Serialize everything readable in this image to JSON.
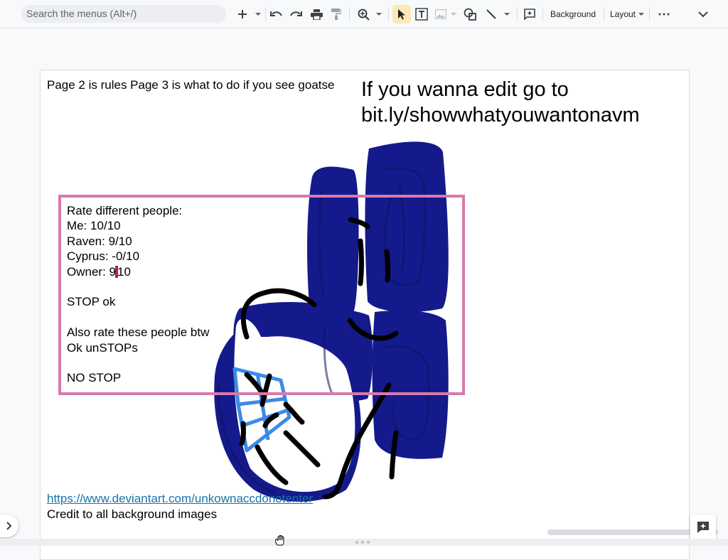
{
  "toolbar": {
    "search_placeholder": "Search the menus (Alt+/)",
    "background_label": "Background",
    "layout_label": "Layout",
    "more_label": "⋯"
  },
  "slide": {
    "top_left_text": "Page 2 is rules Page 3 is what to do if you see goatse",
    "top_right_line1": "If you wanna edit go to",
    "top_right_line2": "bit.ly/showwhatyouwantonavm",
    "rate_lines": [
      "Rate different people:",
      "Me: 10/10",
      "Raven: 9/10",
      "Cyprus: -0/10",
      "",
      "",
      "STOP ok",
      "",
      "Also rate these people btw",
      "Ok unSTOPs",
      "",
      "NO STOP"
    ],
    "owner_prefix": "Owner: 9",
    "owner_suffix": "10",
    "link_text": "https://www.deviantart.com/unkownaccdonotenter",
    "credit_text": "Credit to all background images"
  },
  "colors": {
    "box_border": "#d77aac",
    "logo_blue": "#141a8c",
    "logo_blue_light": "#3c8ae6",
    "link": "#1a73a8",
    "active_tool_bg": "#fde8b8"
  },
  "icons": [
    "plus-icon",
    "undo-icon",
    "redo-icon",
    "print-icon",
    "paint-format-icon",
    "zoom-icon",
    "select-pointer-icon",
    "text-box-icon",
    "image-icon",
    "shape-icon",
    "line-icon",
    "comment-icon",
    "more-icon",
    "chevron-down-icon",
    "chevron-right-icon",
    "assistant-icon",
    "hand-cursor-icon"
  ]
}
